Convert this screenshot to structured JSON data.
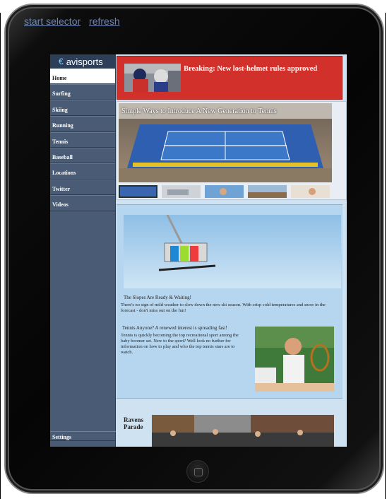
{
  "top_links": {
    "start_selector": "start selector",
    "refresh": "refresh"
  },
  "sidebar": {
    "logo": "avisports",
    "items": [
      {
        "label": "Home",
        "active": true
      },
      {
        "label": "Surfing"
      },
      {
        "label": "Skiing"
      },
      {
        "label": "Running"
      },
      {
        "label": "Tennis"
      },
      {
        "label": "Baseball"
      },
      {
        "label": "Locations"
      },
      {
        "label": "Twitter"
      },
      {
        "label": "Videos"
      }
    ],
    "settings": "Settings"
  },
  "breaking": {
    "headline": "Breaking: New lost-helmet rules approved"
  },
  "feature": {
    "title": "Simple Ways to Introduce A New Generation to Tennis"
  },
  "promo": {
    "ski_heading": "The Slopes Are Ready & Waiting!",
    "ski_text": "There's no sign of mild weather to slow down the new ski season.  With crisp cold temperatures and snow in the forecast - don't miss out on the fun!",
    "tennis_heading": "Tennis Anyone? A renewed interest is spreading fast!",
    "tennis_text": "Tennis is quickly becoming the top recreational sport among the baby boomer set. New to the sport? Well look no further for information on how to play and who the top tennis stars are to watch."
  },
  "ravens": {
    "title": "Ravens Parade"
  },
  "colors": {
    "breaking_red": "#d2302a",
    "sidebar": "#4a5c75",
    "link": "#6f86b2"
  }
}
